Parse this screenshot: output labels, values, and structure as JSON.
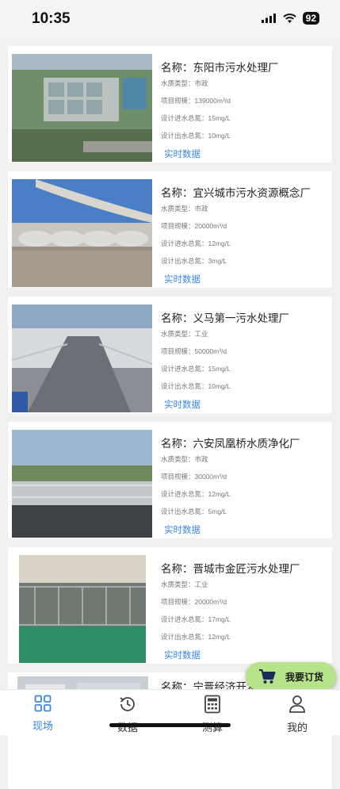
{
  "status": {
    "time": "10:35",
    "battery": "92"
  },
  "labels": {
    "name_prefix": "名称：",
    "water_type": "水质类型：",
    "scale": "项目规模：",
    "in_nitrogen": "设计进水总氮：",
    "out_nitrogen": "设计出水总氮：",
    "realtime": "实时数据"
  },
  "projects": [
    {
      "name": "东阳市污水处理厂",
      "water_type": "市政",
      "scale": "139000m³/d",
      "in_nitrogen": "15mg/L",
      "out_nitrogen": "10mg/L",
      "realtime": "实时数据"
    },
    {
      "name": "宜兴城市污水资源概念厂",
      "water_type": "市政",
      "scale": "20000m³/d",
      "in_nitrogen": "12mg/L",
      "out_nitrogen": "3mg/L",
      "realtime": "实时数据"
    },
    {
      "name": "义马第一污水处理厂",
      "water_type": "工业",
      "scale": "50000m³/d",
      "in_nitrogen": "15mg/L",
      "out_nitrogen": "10mg/L",
      "realtime": "实时数据"
    },
    {
      "name": "六安凤凰桥水质净化厂",
      "water_type": "市政",
      "scale": "30000m³/d",
      "in_nitrogen": "12mg/L",
      "out_nitrogen": "5mg/L",
      "realtime": "实时数据"
    },
    {
      "name": "晋城市金匠污水处理厂",
      "water_type": "工业",
      "scale": "20000m³/d",
      "in_nitrogen": "17mg/L",
      "out_nitrogen": "12mg/L",
      "realtime": "实时数据"
    },
    {
      "name": "宁晋经济开发"
    }
  ],
  "order_button": {
    "label": "我要订货"
  },
  "tabs": [
    {
      "label": "现场",
      "icon": "grid-icon"
    },
    {
      "label": "数据",
      "icon": "history-icon"
    },
    {
      "label": "测算",
      "icon": "calculator-icon"
    },
    {
      "label": "我的",
      "icon": "user-icon"
    }
  ],
  "colors": {
    "accent": "#3a86e8",
    "order_button": "#b7e48a"
  }
}
